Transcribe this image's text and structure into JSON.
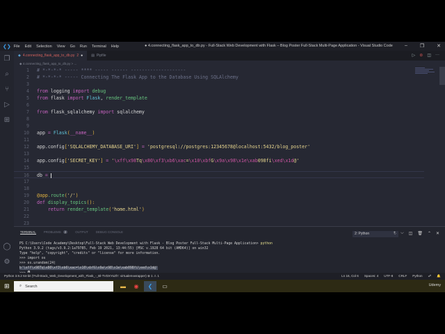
{
  "titlebar": {
    "menu": [
      "File",
      "Edit",
      "Selection",
      "View",
      "Go",
      "Run",
      "Terminal",
      "Help"
    ],
    "title": "● 4.connecting_flask_app_to_db.py - Full-Stack Web Development with Flask – Blog Poster Full-Stack Multi-Page Application - Visual Studio Code",
    "minimize": "–",
    "restore": "❐",
    "close": "✕"
  },
  "tabs": [
    {
      "label": "4.connecting_flask_app_to_db.py",
      "badge": "2",
      "dirty": "●"
    },
    {
      "label": "Pipfile"
    }
  ],
  "breadcrumb": "◆ 4.connecting_flask_app_to_db.py > ...",
  "editor": {
    "lines": [
      [
        {
          "t": "# *-*-*-* ----- **** ----- ------ --------------------",
          "c": "cm"
        }
      ],
      [
        {
          "t": "# *-*-*-* ----- Connecting The Flask App to the Database Using SQLAlchemy",
          "c": "cm"
        }
      ],
      [],
      [
        {
          "t": "from ",
          "c": "kw"
        },
        {
          "t": "logging ",
          "c": "pl"
        },
        {
          "t": "import ",
          "c": "kw"
        },
        {
          "t": "debug",
          "c": "fn"
        }
      ],
      [
        {
          "t": "from ",
          "c": "kw"
        },
        {
          "t": "flask ",
          "c": "pl"
        },
        {
          "t": "import ",
          "c": "kw"
        },
        {
          "t": "Flask",
          "c": "cl"
        },
        {
          "t": ", ",
          "c": "pl"
        },
        {
          "t": "render_template",
          "c": "fn"
        }
      ],
      [],
      [
        {
          "t": "from ",
          "c": "kw"
        },
        {
          "t": "flask_sqlalchemy ",
          "c": "pl"
        },
        {
          "t": "import ",
          "c": "kw"
        },
        {
          "t": "sqlalchemy",
          "c": "pl"
        }
      ],
      [],
      [],
      [
        {
          "t": "app ",
          "c": "pl"
        },
        {
          "t": "= ",
          "c": "kw"
        },
        {
          "t": "Flask",
          "c": "cl"
        },
        {
          "t": "(",
          "c": "br"
        },
        {
          "t": "__name__",
          "c": "kw"
        },
        {
          "t": ")",
          "c": "br"
        }
      ],
      [],
      [
        {
          "t": "app.config",
          "c": "pl"
        },
        {
          "t": "[",
          "c": "br"
        },
        {
          "t": "'SQLALCHEMY_DATABASE_URI'",
          "c": "st"
        },
        {
          "t": "]",
          "c": "br"
        },
        {
          "t": " = ",
          "c": "kw"
        },
        {
          "t": "'postgresql://postgres:12345678@localhost:5432/blog_poster'",
          "c": "st"
        }
      ],
      [],
      [
        {
          "t": "app.config",
          "c": "pl"
        },
        {
          "t": "[",
          "c": "br"
        },
        {
          "t": "'SECRET_KEY'",
          "c": "st"
        },
        {
          "t": "]",
          "c": "br"
        },
        {
          "t": " = ",
          "c": "kw"
        },
        {
          "t": "'",
          "c": "st"
        },
        {
          "t": "\\xff\\x98",
          "c": "esc"
        },
        {
          "t": "Tq",
          "c": "st"
        },
        {
          "t": "\\x80\\xf3\\xb6\\xac",
          "c": "esc"
        },
        {
          "t": "=",
          "c": "st"
        },
        {
          "t": "\\x10\\xbf",
          "c": "esc"
        },
        {
          "t": "G",
          "c": "st"
        },
        {
          "t": "\\x9a\\x98\\x1e\\xab",
          "c": "esc"
        },
        {
          "t": "098fi",
          "c": "st"
        },
        {
          "t": "\\xed\\x1d",
          "c": "esc"
        },
        {
          "t": "@'",
          "c": "st"
        }
      ],
      [],
      [
        {
          "t": "db ",
          "c": "pl"
        },
        {
          "t": "= ",
          "c": "kw"
        }
      ],
      [],
      [],
      [
        {
          "t": "@app",
          "c": "dec"
        },
        {
          "t": ".route",
          "c": "fn"
        },
        {
          "t": "(",
          "c": "br"
        },
        {
          "t": "'/'",
          "c": "st"
        },
        {
          "t": ")",
          "c": "br"
        }
      ],
      [
        {
          "t": "def ",
          "c": "kw"
        },
        {
          "t": "display_topics",
          "c": "fn"
        },
        {
          "t": "():",
          "c": "br"
        }
      ],
      [
        {
          "t": "    return ",
          "c": "kw"
        },
        {
          "t": "render_template",
          "c": "fn"
        },
        {
          "t": "(",
          "c": "br"
        },
        {
          "t": "'home.html'",
          "c": "st"
        },
        {
          "t": ")",
          "c": "br"
        }
      ],
      [],
      []
    ],
    "current_line": 16
  },
  "panel": {
    "tabs": [
      {
        "label": "TERMINAL"
      },
      {
        "label": "PROBLEMS",
        "badge": "2"
      },
      {
        "label": "OUTPUT"
      },
      {
        "label": "DEBUG CONSOLE"
      }
    ],
    "terminal_select": "2: Python",
    "actions": [
      "+",
      "⌵",
      "◫",
      "🗑",
      "⌃",
      "✕"
    ],
    "terminal": {
      "l1": "PS C:\\Users\\Code Academy\\Desktop\\Full-Stack Web Development with Flask - Blog Poster Full-Stack Multi-Page Application> ",
      "l1cmd": "python",
      "l2": "Python 3.9.2 (tags/v3.9.2:1a79785, Feb 19 2021, 13:44:55) [MSC v.1928 64 bit (AMD64)] on win32",
      "l3": "Type \"help\", \"copyright\", \"credits\" or \"license\" for more information.",
      "l4": ">>> import os",
      "l5": ">>> os.urandom(24)",
      "l6": "b'\\xff\\x98Tq\\x80\\xf3\\xb6\\xac=\\x10\\xbfG\\x9a\\x98\\x1e\\xab098fi\\xed\\x1d@'",
      "l7": ">>> "
    }
  },
  "statusbar": {
    "left": "Python 3.9.2 64-bit ('Full-Stack_Web_Development_with_Flask_-_Bl-TVDXYoZh': virtualenvwrapper)   ⊗ 1 ⚠ 1",
    "right": [
      "Ln 16, Col 6",
      "Spaces: 4",
      "UTF-8",
      "CRLF",
      "Python",
      "☍",
      "🔔"
    ]
  },
  "taskbar": {
    "search_placeholder": "Search",
    "watermark": "Udemy"
  }
}
